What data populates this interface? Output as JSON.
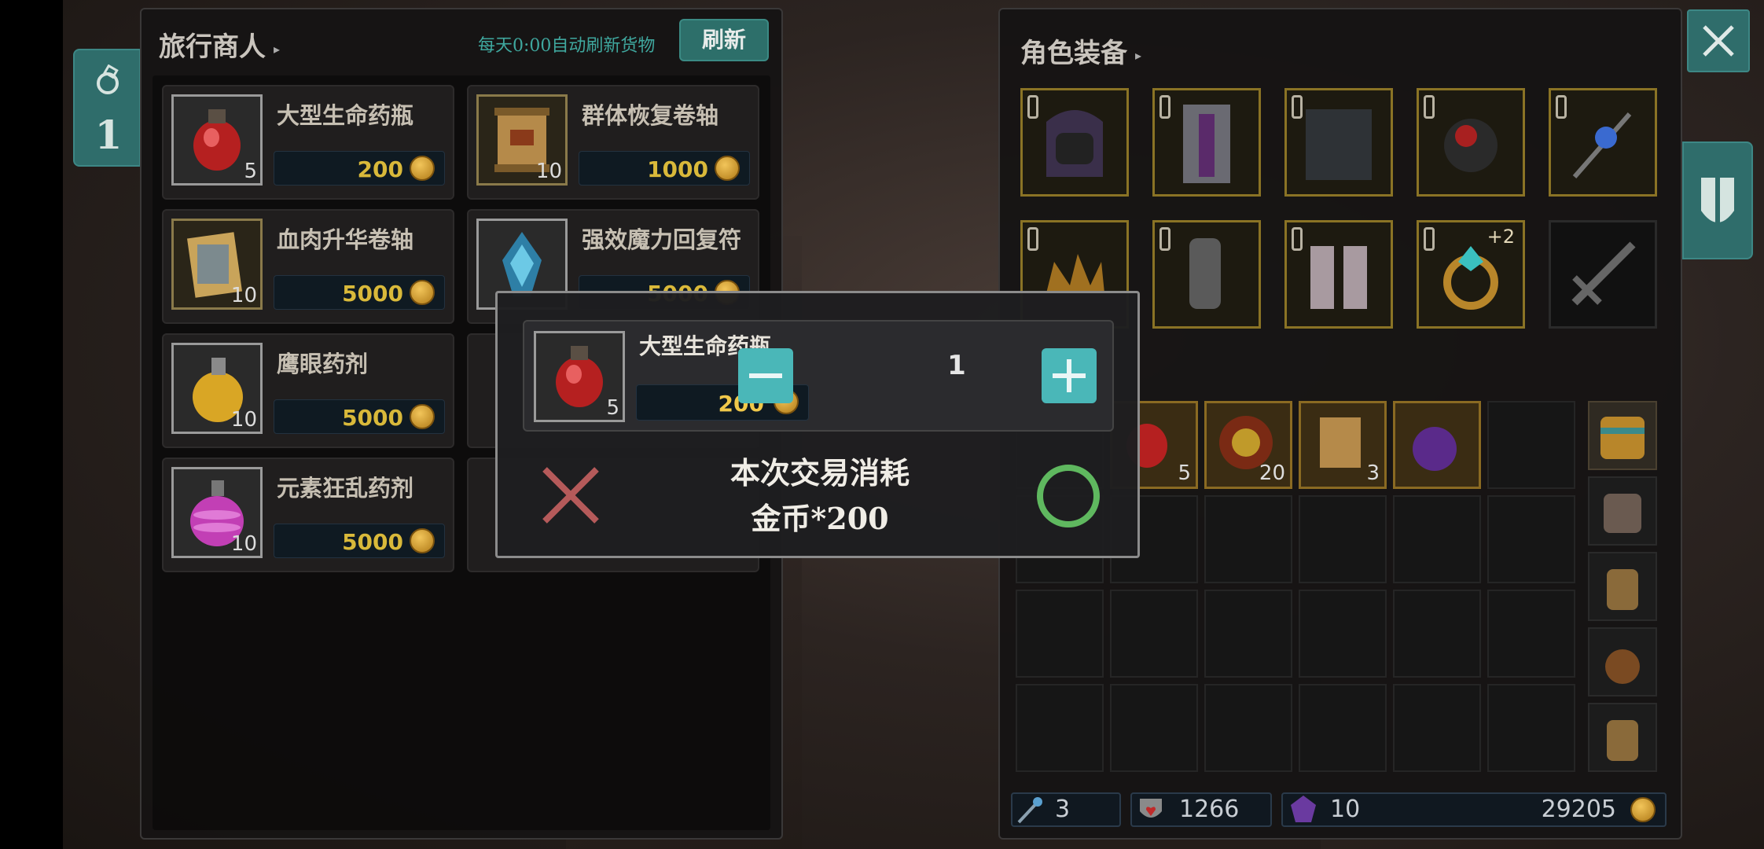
{
  "merchant": {
    "title": "旅行商人",
    "refresh_note": "每天0:00自动刷新货物",
    "refresh_label": "刷新",
    "items": [
      {
        "name": "大型生命药瓶",
        "qty": "5",
        "price": "200"
      },
      {
        "name": "群体恢复卷轴",
        "qty": "10",
        "price": "1000"
      },
      {
        "name": "血肉升华卷轴",
        "qty": "10",
        "price": "5000"
      },
      {
        "name": "强效魔力回复符",
        "qty": "",
        "price": "5000"
      },
      {
        "name": "鹰眼药剂",
        "qty": "10",
        "price": "5000"
      },
      {
        "name": "元素狂乱药剂",
        "qty": "10",
        "price": "5000"
      }
    ]
  },
  "side_tab": {
    "count": "1"
  },
  "equipment": {
    "title": "角色装备",
    "ring_bonus": "+2"
  },
  "inventory": {
    "items": [
      {
        "qty": "5"
      },
      {
        "qty": "20"
      },
      {
        "qty": "3"
      },
      {
        "qty": ""
      }
    ]
  },
  "stats": {
    "wand": "3",
    "hearts": "1266",
    "crystals": "10",
    "gold": "29205"
  },
  "modal": {
    "item_name": "大型生命药瓶",
    "item_qty": "5",
    "item_price": "200",
    "quantity": "1",
    "cost_line1": "本次交易消耗",
    "cost_line2": "金币*200"
  },
  "colors": {
    "accent_teal": "#2f6d6b",
    "step_button": "#4ab7b8",
    "price_gold": "#d9b93a",
    "confirm_green": "#5fb85f",
    "cancel_red": "#b55a5a"
  }
}
